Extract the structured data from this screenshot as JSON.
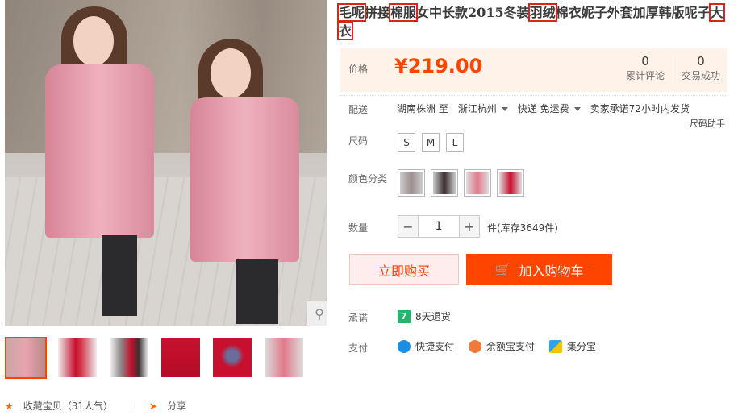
{
  "title": {
    "segments": [
      "毛呢",
      "拼接",
      "棉服",
      "女中长款2015冬装",
      "羽绒",
      "棉衣妮子外套加厚韩版呢子",
      "大衣"
    ]
  },
  "price": {
    "label": "价格",
    "value": "¥219.00",
    "reviews_count": "0",
    "reviews_label": "累计评论",
    "sales_count": "0",
    "sales_label": "交易成功"
  },
  "shipping": {
    "label": "配送",
    "from": "湖南株洲 至",
    "to": "浙江杭州",
    "method": "快递 免运费",
    "promise": "卖家承诺72小时内发货",
    "size_helper": "尺码助手"
  },
  "size": {
    "label": "尺码",
    "options": [
      "S",
      "M",
      "L"
    ]
  },
  "color": {
    "label": "颜色分类",
    "swatches": [
      "#9b8f90",
      "#3b2f30",
      "#e07a8a",
      "#c8102e"
    ]
  },
  "quantity": {
    "label": "数量",
    "value": "1",
    "minus": "−",
    "plus": "+",
    "stock": "件(库存3649件)"
  },
  "actions": {
    "buy_now": "立即购买",
    "add_to_cart": "加入购物车"
  },
  "promise": {
    "label": "承诺",
    "badge": "7",
    "text": "8天退货"
  },
  "payment": {
    "label": "支付",
    "methods": [
      "快捷支付",
      "余额宝支付",
      "集分宝"
    ]
  },
  "footer": {
    "favorite": "收藏宝贝（31人气）",
    "share": "分享"
  },
  "colors": {
    "accent": "#ff4400",
    "price_bg": "#fff2e8",
    "highlight": "#d9261c"
  }
}
